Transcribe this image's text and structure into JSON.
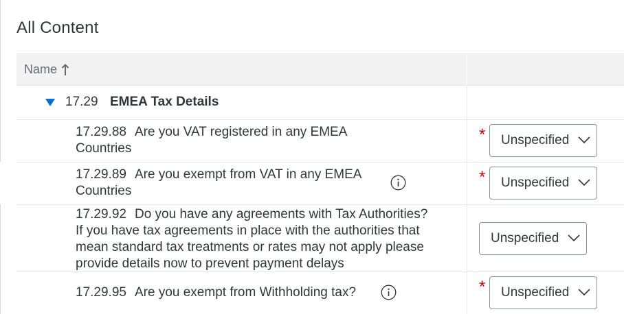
{
  "page": {
    "title": "All Content"
  },
  "table": {
    "column_name": "Name",
    "group": {
      "number": "17.29",
      "title": "EMEA Tax Details"
    },
    "rows": [
      {
        "number": "17.29.88",
        "line1": "Are you VAT registered in any EMEA",
        "line2": "Countries",
        "required": "*",
        "value": "Unspecified"
      },
      {
        "number": "17.29.89",
        "line1": "Are you exempt from VAT in any EMEA",
        "line2": "Countries",
        "required": "*",
        "value": "Unspecified"
      },
      {
        "number": "17.29.92",
        "line1": "Do you have any agreements with Tax Authorities?",
        "line2": "If you have tax agreements in place with the authorities that",
        "line3": "mean standard tax treatments or rates may not apply please",
        "line4": "provide details now to prevent payment delays",
        "value": "Unspecified"
      },
      {
        "number": "17.29.95",
        "line1": "Are you exempt from Withholding tax?",
        "required": "*",
        "value": "Unspecified"
      }
    ]
  },
  "icons": {
    "sort": "arrow-up-icon",
    "expand": "triangle-down-icon",
    "info": "info-icon",
    "dropdown": "chevron-down-icon"
  },
  "colors": {
    "required": "#e00000",
    "expand_toggle": "#0a6ed1",
    "header_bg": "#f2f2f2"
  }
}
